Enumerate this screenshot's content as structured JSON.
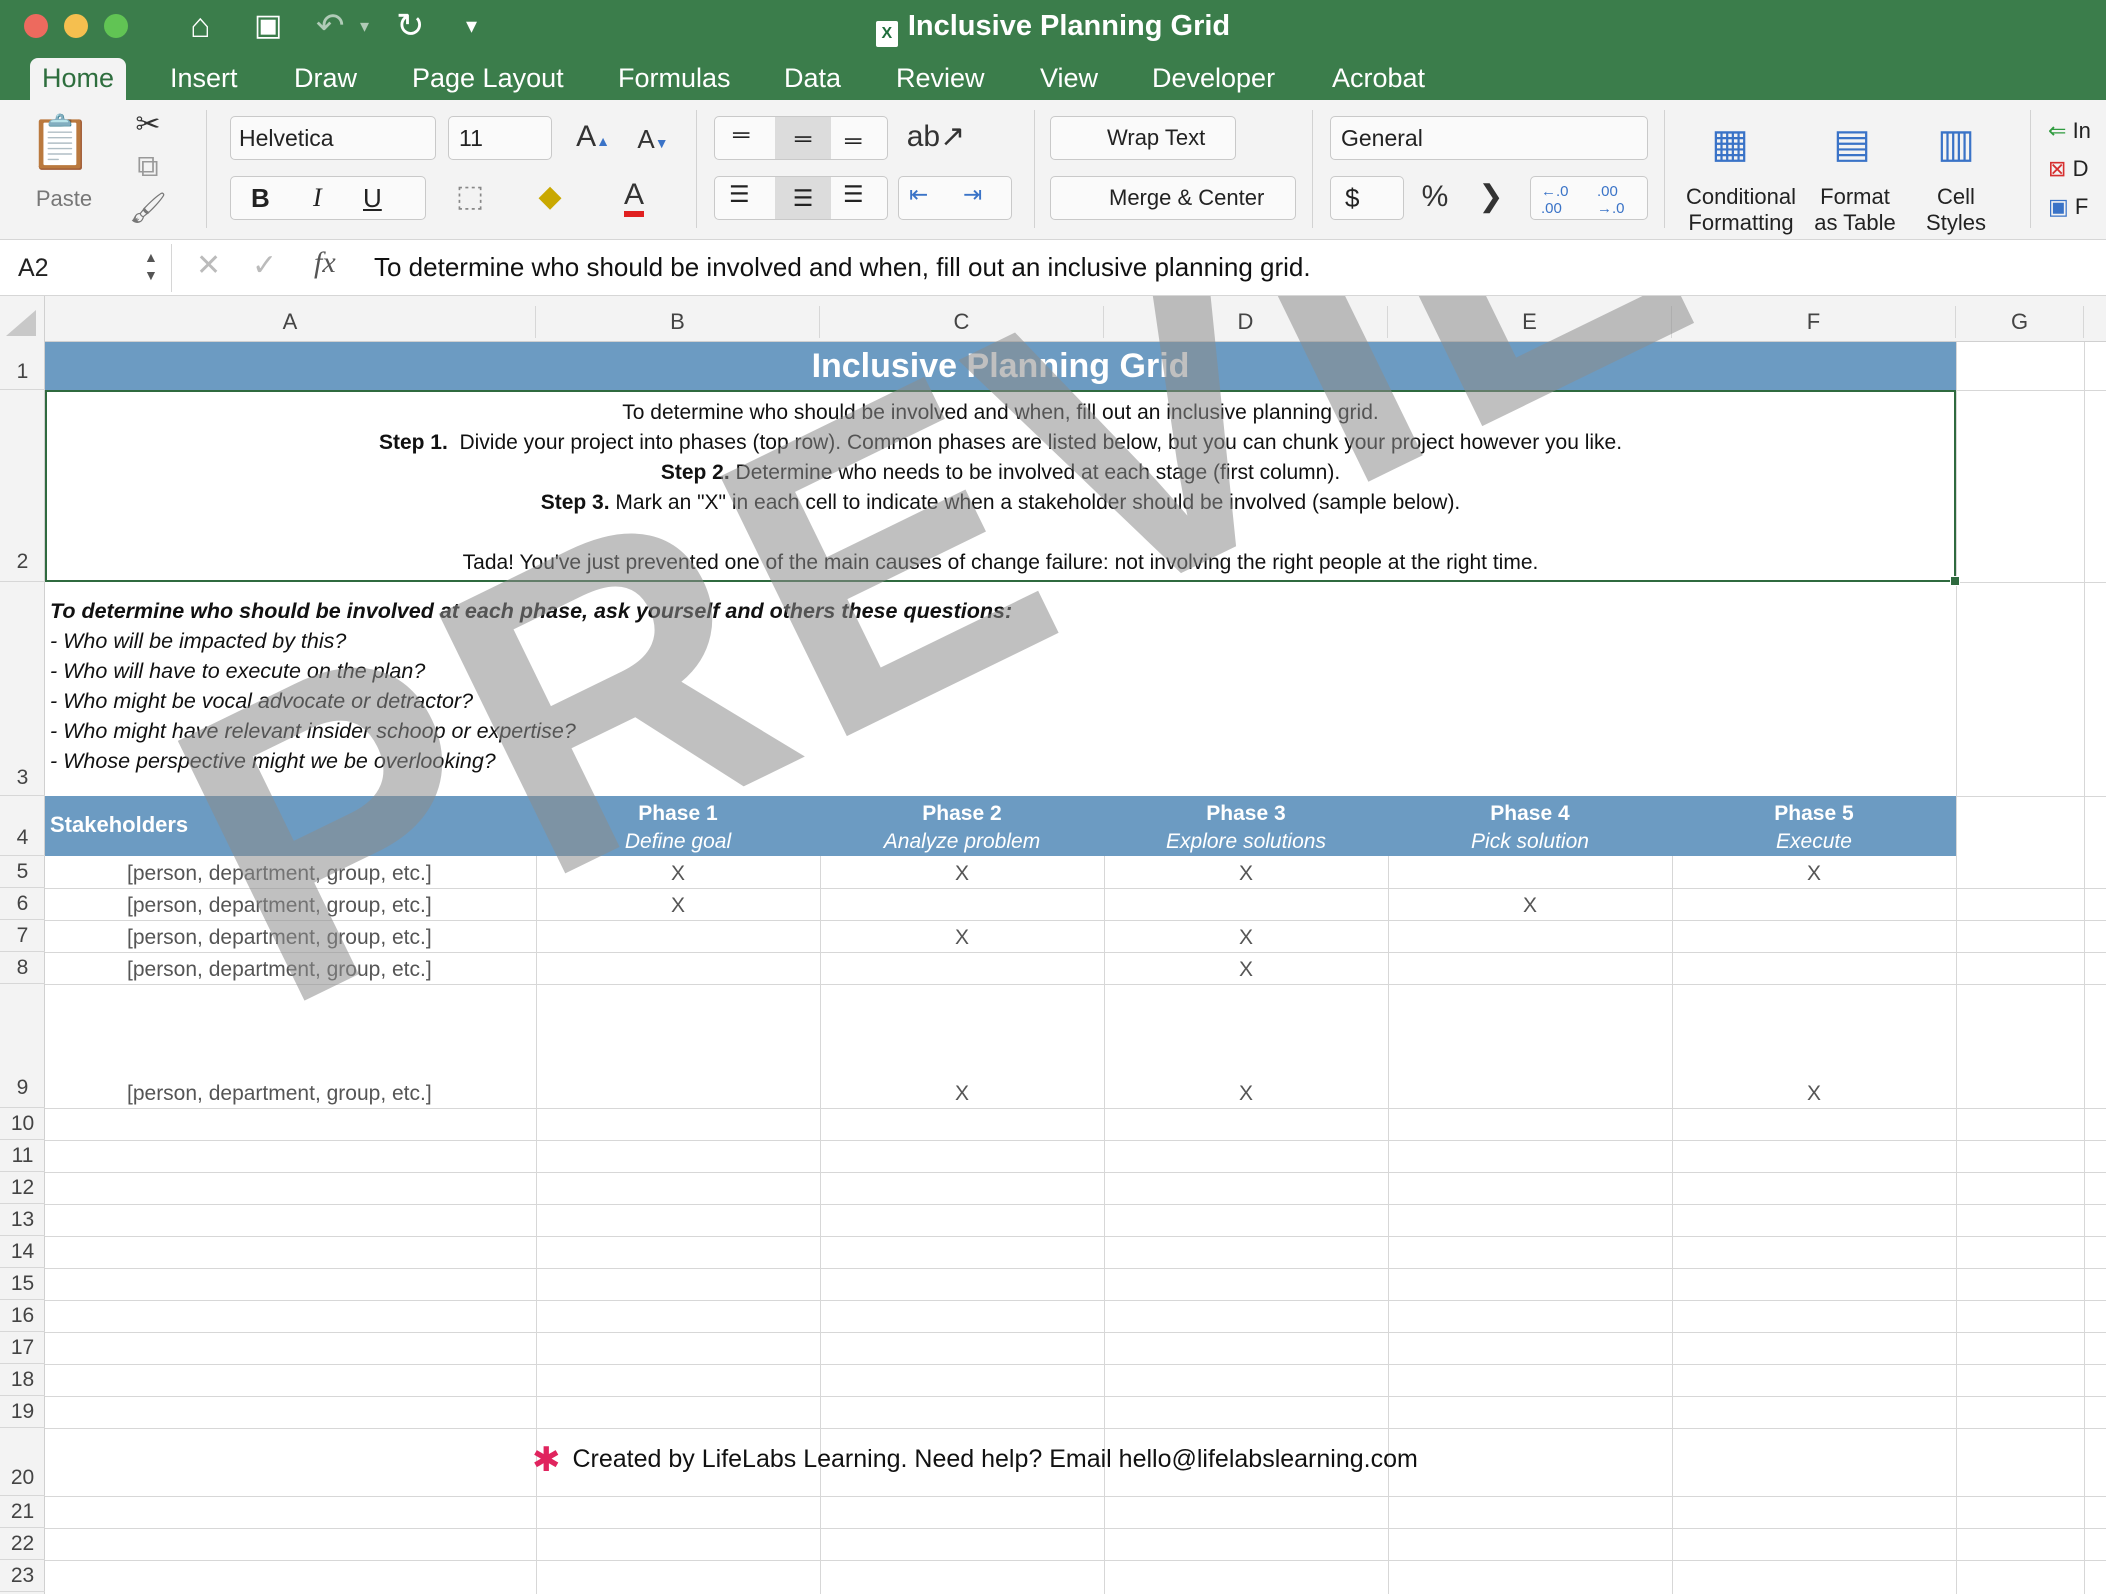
{
  "window": {
    "title": "Inclusive Planning Grid"
  },
  "ribbon_tabs": [
    "Home",
    "Insert",
    "Draw",
    "Page Layout",
    "Formulas",
    "Data",
    "Review",
    "View",
    "Developer",
    "Acrobat"
  ],
  "ribbon": {
    "paste_label": "Paste",
    "font_name": "Helvetica",
    "font_size": "11",
    "wrap_text": "Wrap Text",
    "merge_center": "Merge & Center",
    "number_format": "General",
    "conditional_formatting": [
      "Conditional",
      "Formatting"
    ],
    "format_as_table": [
      "Format",
      "as Table"
    ],
    "cell_styles": [
      "Cell",
      "Styles"
    ],
    "right_cut": [
      "In",
      "D",
      "F"
    ]
  },
  "formula_bar": {
    "name_box": "A2",
    "formula": "To determine who should be involved and when, fill out an inclusive planning grid."
  },
  "columns": [
    "A",
    "B",
    "C",
    "D",
    "E",
    "F",
    "G"
  ],
  "rows": [
    "1",
    "2",
    "3",
    "4",
    "5",
    "6",
    "7",
    "8",
    "9",
    "10",
    "11",
    "12",
    "13",
    "14",
    "15",
    "16",
    "17",
    "18",
    "19",
    "20",
    "21",
    "22",
    "23"
  ],
  "sheet": {
    "title": "Inclusive Planning Grid",
    "instructions": {
      "line1": "To determine who should be involved and when, fill out an inclusive planning grid.",
      "step1_label": "Step 1.",
      "step1_text": "  Divide your project into phases (top row). Common phases are listed below, but you can chunk your project however you like.",
      "step2_label": "Step 2.",
      "step2_text": " Determine who needs to be involved at each stage (first column).",
      "step3_label": "Step 3.",
      "step3_text": " Mark an \"X\" in each cell to indicate when a stakeholder should be involved (sample below).",
      "tada": "Tada! You've just prevented one of the main causes of change failure: not involving the right people at the right time."
    },
    "questions": {
      "heading": "To determine who should be involved at each phase, ask yourself and others these questions:",
      "items": [
        "- Who will be impacted by this?",
        "- Who will have to execute on the plan?",
        "- Who might be vocal advocate or detractor?",
        "- Who might have relevant insider schoop or expertise?",
        "- Whose perspective might we be overlooking?"
      ]
    },
    "header": {
      "stakeholders": "Stakeholders",
      "phases": [
        {
          "name": "Phase 1",
          "desc": "Define goal"
        },
        {
          "name": "Phase 2",
          "desc": "Analyze problem"
        },
        {
          "name": "Phase 3",
          "desc": "Explore solutions"
        },
        {
          "name": "Phase 4",
          "desc": "Pick solution"
        },
        {
          "name": "Phase 5",
          "desc": "Execute"
        }
      ]
    },
    "stakeholder_rows": [
      {
        "label": "[person, department, group, etc.]",
        "marks": [
          "X",
          "X",
          "X",
          "",
          "X"
        ]
      },
      {
        "label": "[person, department, group, etc.]",
        "marks": [
          "X",
          "",
          "",
          "X",
          ""
        ]
      },
      {
        "label": "[person, department, group, etc.]",
        "marks": [
          "",
          "X",
          "X",
          "",
          ""
        ]
      },
      {
        "label": "[person, department, group, etc.]",
        "marks": [
          "",
          "",
          "X",
          "",
          ""
        ]
      },
      {
        "label": "[person, department, group, etc.]",
        "marks": [
          "",
          "X",
          "X",
          "",
          "X"
        ]
      }
    ],
    "footer": "Created by LifeLabs Learning. Need help? Email hello@lifelabslearning.com"
  },
  "watermark": "PREVIEW",
  "colors": {
    "title_bar": "#3b7d4b",
    "header_band": "#6c9bc2",
    "selection_border": "#2f6a3f"
  }
}
